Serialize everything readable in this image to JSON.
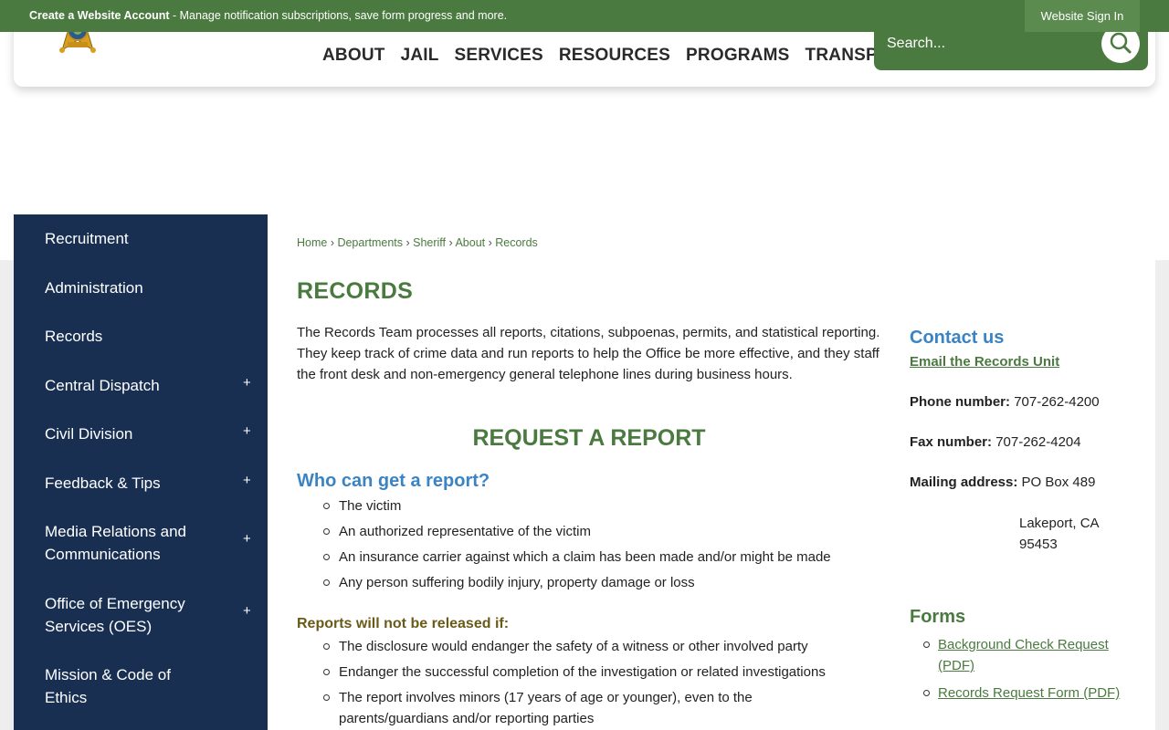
{
  "topbar": {
    "account_link": "Create a Website Account",
    "account_desc": " - Manage notification subscriptions, save form progress and more.",
    "sign_in": "Website Sign In"
  },
  "nav": [
    "ABOUT",
    "JAIL",
    "SERVICES",
    "RESOURCES",
    "PROGRAMS",
    "TRANSPARENCY"
  ],
  "search": {
    "placeholder": "Search..."
  },
  "sidebar": {
    "items": [
      {
        "label": "Recruitment",
        "expand": ""
      },
      {
        "label": "Administration",
        "expand": ""
      },
      {
        "label": "Records",
        "expand": ""
      },
      {
        "label": "Central Dispatch",
        "expand": "+"
      },
      {
        "label": "Civil Division",
        "expand": "+"
      },
      {
        "label": "Feedback & Tips",
        "expand": "+"
      },
      {
        "label": "Media Relations and Communications",
        "expand": "+"
      },
      {
        "label": "Office of Emergency Services (OES)",
        "expand": "+"
      },
      {
        "label": "Mission & Code of Ethics",
        "expand": ""
      }
    ]
  },
  "breadcrumb": [
    "Home",
    "Departments",
    "Sheriff",
    "About",
    "Records"
  ],
  "main": {
    "title": "RECORDS",
    "intro": "The Records Team processes all reports, citations, subpoenas, permits, and statistical reporting. They keep track of crime data and run reports to help the Office be more effective, and they staff the front desk and non-emergency general telephone lines during business hours.",
    "request_heading": "REQUEST A REPORT",
    "who_heading": "Who can get a report?",
    "who_list": [
      "The victim",
      "An authorized representative of the victim",
      "An insurance carrier against which a claim has been made and/or might be made",
      "Any person suffering bodily injury, property damage or loss"
    ],
    "not_released_heading": "Reports will not be released if:",
    "not_released_list": [
      "The disclosure would endanger the safety of a witness or other involved party",
      "Endanger the successful completion of the investigation or related investigations",
      "The report involves minors (17 years of age or younger), even to the parents/guardians and/or reporting parties"
    ]
  },
  "contact": {
    "heading": "Contact us",
    "email_link": "Email the Records Unit",
    "phone_label": "Phone number:",
    "phone": "707-262-4200",
    "fax_label": "Fax number:",
    "fax": "707-262-4204",
    "mail_label": "Mailing address:",
    "mail_line1": "PO Box 489",
    "mail_line2": "Lakeport, CA",
    "mail_line3": "95453"
  },
  "forms": {
    "heading": "Forms",
    "links": [
      "Background Check Request (PDF)",
      "Records Request Form (PDF)"
    ]
  },
  "colors": {
    "brand_green": "#4a7a3f",
    "sidebar_navy": "#182f52",
    "heading_blue": "#3a84c4",
    "heading_olive": "#6a5a18"
  }
}
